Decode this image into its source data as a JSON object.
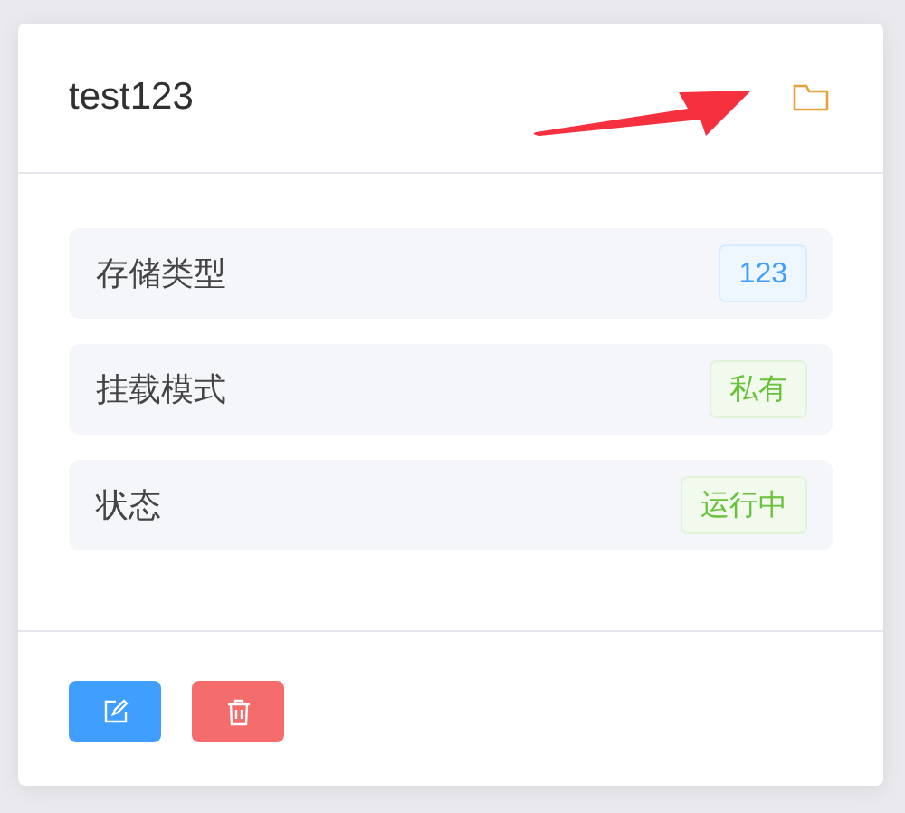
{
  "card": {
    "title": "test123",
    "rows": [
      {
        "label": "存储类型",
        "tag": {
          "text": "123",
          "color": "#409eff"
        }
      },
      {
        "label": "挂载模式",
        "tag": {
          "text": "私有",
          "color": "#67c23a"
        }
      },
      {
        "label": "状态",
        "tag": {
          "text": "运行中",
          "color": "#67c23a"
        }
      }
    ],
    "actions": [
      {
        "kind": "edit"
      },
      {
        "kind": "delete"
      }
    ]
  },
  "annotations": [
    {
      "kind": "arrow"
    }
  ]
}
